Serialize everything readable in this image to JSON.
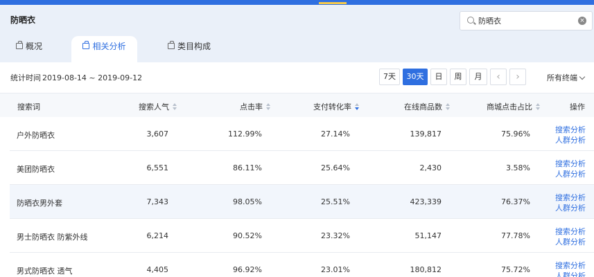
{
  "header": {
    "title": "防晒衣",
    "search_value": "防晒衣"
  },
  "tabs": [
    {
      "label": "概况"
    },
    {
      "label": "相关分析"
    },
    {
      "label": "类目构成"
    }
  ],
  "toolbar": {
    "period_label": "统计时间",
    "period_value": "2019-08-14 ~ 2019-09-12",
    "buttons": [
      "7天",
      "30天",
      "日",
      "周",
      "月"
    ],
    "prev": "‹",
    "next": "›",
    "terminal": "所有终端"
  },
  "table": {
    "headers": [
      "搜索词",
      "搜索人气",
      "点击率",
      "支付转化率",
      "在线商品数",
      "商城点击占比",
      "操作"
    ],
    "rows": [
      {
        "term": "户外防晒衣",
        "popularity": "3,607",
        "ctr": "112.99%",
        "conversion": "27.14%",
        "items": "139,817",
        "mall_share": "75.96%"
      },
      {
        "term": "美团防晒衣",
        "popularity": "6,551",
        "ctr": "86.11%",
        "conversion": "25.64%",
        "items": "2,430",
        "mall_share": "3.58%"
      },
      {
        "term": "防晒衣男外套",
        "popularity": "7,343",
        "ctr": "98.05%",
        "conversion": "25.51%",
        "items": "423,339",
        "mall_share": "76.37%"
      },
      {
        "term": "男士防晒衣 防紫外线",
        "popularity": "6,214",
        "ctr": "90.52%",
        "conversion": "23.32%",
        "items": "51,147",
        "mall_share": "77.78%"
      },
      {
        "term": "男式防晒衣 透气",
        "popularity": "4,405",
        "ctr": "96.92%",
        "conversion": "23.01%",
        "items": "180,812",
        "mall_share": "75.72%"
      }
    ],
    "action_search": "搜索分析",
    "action_crowd": "人群分析"
  }
}
